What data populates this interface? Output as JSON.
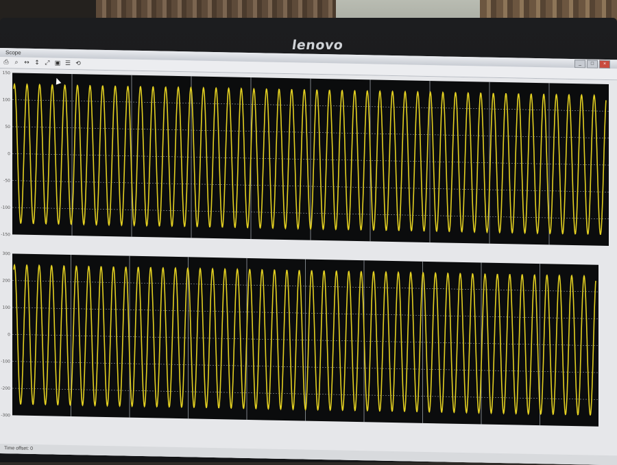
{
  "monitor": {
    "brand": "lenovo"
  },
  "window": {
    "title": "Scope"
  },
  "toolbar": {
    "tools": [
      "print-icon",
      "zoom-icon",
      "zoom-x-icon",
      "zoom-y-icon",
      "autoscale-icon",
      "save-axes-icon",
      "params-icon",
      "restore-icon"
    ]
  },
  "status": {
    "text": "Time offset: 0"
  },
  "colors": {
    "trace": "#e3d021",
    "axes_bg": "#0b0c0d",
    "grid": "#9aa0a6"
  },
  "chart_data": [
    {
      "type": "line",
      "title": "",
      "series": [
        {
          "cycles": 47,
          "amplitude": 1.0,
          "offset": 0.0
        }
      ],
      "y_tick_labels": [
        "150",
        "100",
        "50",
        "0",
        "-50",
        "-100",
        "-150"
      ],
      "ylim": [
        -150,
        150
      ],
      "grid": true
    },
    {
      "type": "line",
      "title": "",
      "series": [
        {
          "cycles": 47,
          "amplitude": 1.0,
          "offset": 0.0
        }
      ],
      "y_tick_labels": [
        "300",
        "200",
        "100",
        "0",
        "-100",
        "-200",
        "-300"
      ],
      "ylim": [
        -300,
        300
      ],
      "grid": true
    }
  ]
}
